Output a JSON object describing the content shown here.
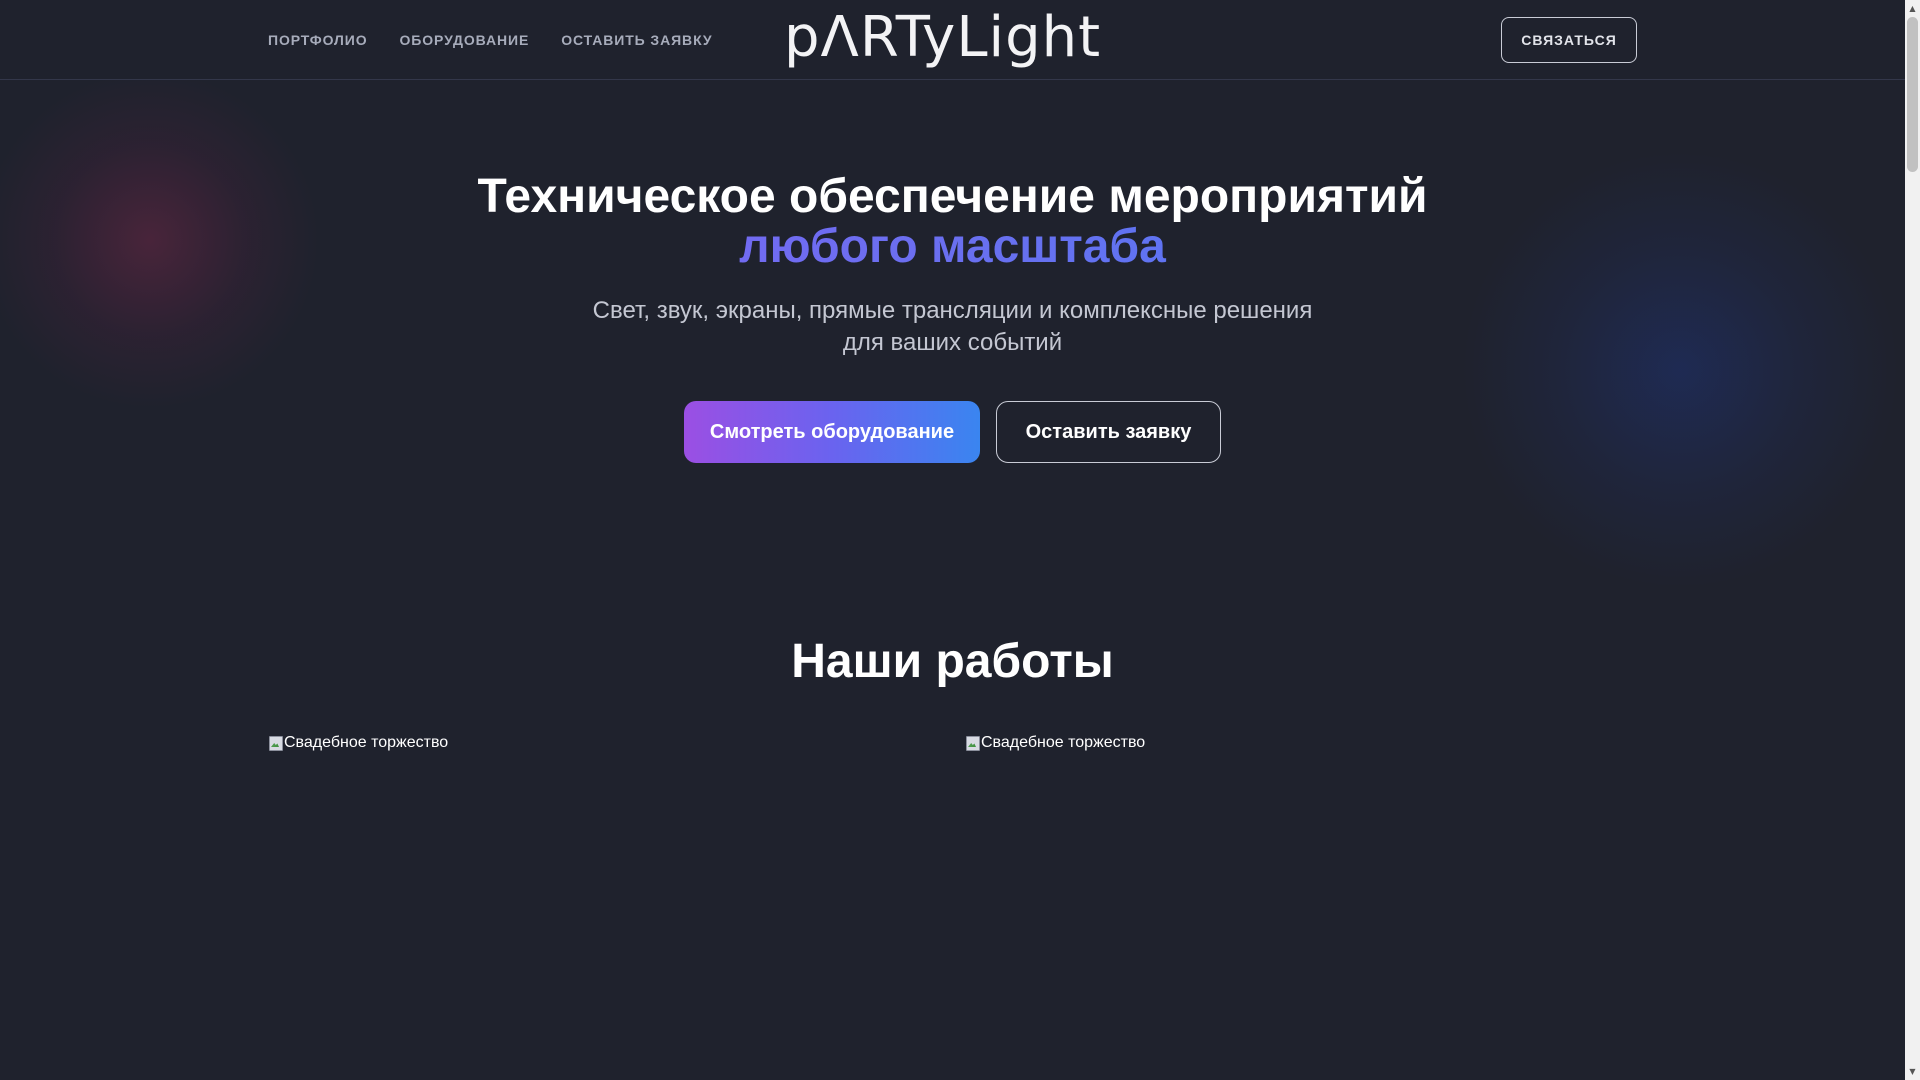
{
  "header": {
    "nav": [
      {
        "label": "ПОРТФОЛИО"
      },
      {
        "label": "ОБОРУДОВАНИЕ"
      },
      {
        "label": "ОСТАВИТЬ ЗАЯВКУ"
      }
    ],
    "logo_text": "pΛRTyLight",
    "contact_label": "СВЯЗАТЬСЯ"
  },
  "hero": {
    "title_line1": "Техническое обеспечение мероприятий",
    "title_line2": "любого масштаба",
    "subtitle_line1": "Свет, звук, экраны, прямые трансляции и комплексные решения",
    "subtitle_line2": "для ваших событий",
    "primary_button": "Смотреть оборудование",
    "secondary_button": "Оставить заявку",
    "accent_gradient": [
      "#8b5cf6",
      "#3b82f6"
    ]
  },
  "works": {
    "title": "Наши работы",
    "items": [
      {
        "alt": "Свадебное торжество",
        "icon": "broken-image-icon"
      },
      {
        "alt": "Свадебное торжество",
        "icon": "broken-image-icon"
      }
    ]
  },
  "colors": {
    "background": "#1f222d",
    "nav_text": "#a7acbb"
  }
}
